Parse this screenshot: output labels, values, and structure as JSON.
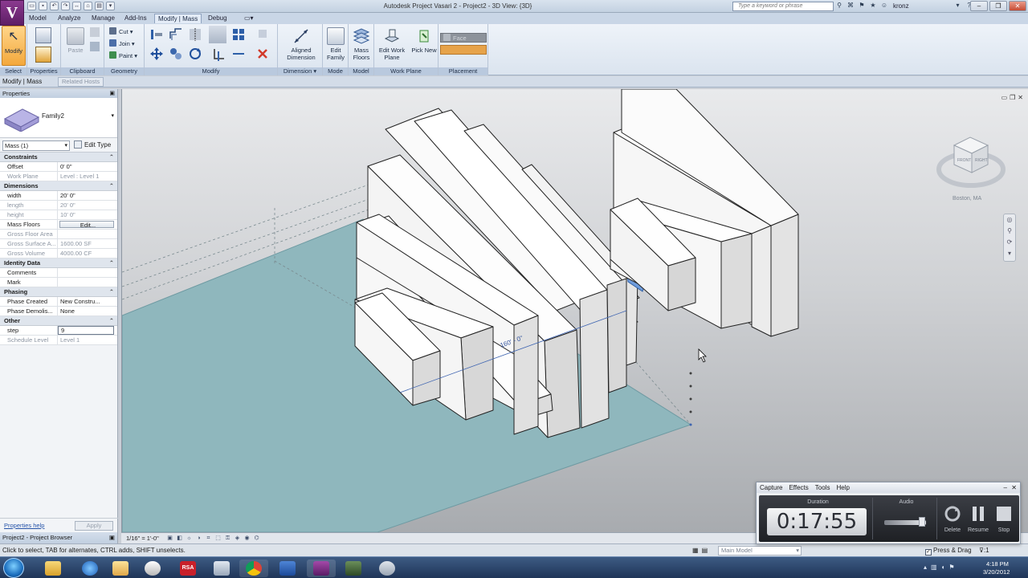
{
  "app": {
    "logo_letter": "V",
    "window_title": "Autodesk Project Vasari 2 - Project2 - 3D View: {3D}",
    "search_placeholder": "Type a keyword or phrase",
    "user_name": "kronz"
  },
  "ribbon_tabs": [
    "Model",
    "Analyze",
    "Manage",
    "Add-Ins",
    "Modify | Mass",
    "Debug"
  ],
  "active_tab": "Modify | Mass",
  "ribbon": {
    "modify_label": "Modify",
    "paste_label": "Paste",
    "cut_label": "Cut",
    "join_label": "Join",
    "paint_label": "Paint",
    "aligned_dimension_label": "Aligned Dimension",
    "edit_family_label": "Edit Family",
    "mass_floors_label": "Mass Floors",
    "edit_work_plane_label": "Edit Work Plane",
    "pick_new_label": "Pick New",
    "face_label": "Face",
    "groups": [
      "Select",
      "Properties",
      "Clipboard",
      "Geometry",
      "Modify",
      "Dimension",
      "Mode",
      "Model",
      "Work Plane",
      "Placement"
    ]
  },
  "options_bar": {
    "mode": "Modify | Mass",
    "related_hosts": "Related Hosts"
  },
  "properties": {
    "header": "Properties",
    "family_name": "Family2",
    "instance_filter": "Mass (1)",
    "edit_type": "Edit Type",
    "sections": [
      {
        "title": "Constraints",
        "rows": [
          {
            "name": "Offset",
            "value": "0' 0\"",
            "dim": false
          },
          {
            "name": "Work Plane",
            "value": "Level : Level 1",
            "dim": true
          }
        ]
      },
      {
        "title": "Dimensions",
        "rows": [
          {
            "name": "width",
            "value": "20' 0\"",
            "dim": false
          },
          {
            "name": "length",
            "value": "20' 0\"",
            "dim": true
          },
          {
            "name": "height",
            "value": "10' 0\"",
            "dim": true
          },
          {
            "name": "Mass Floors",
            "value": "Edit...",
            "dim": false,
            "button": true
          },
          {
            "name": "Gross Floor Area",
            "value": "",
            "dim": true
          },
          {
            "name": "Gross Surface A...",
            "value": "1600.00 SF",
            "dim": true
          },
          {
            "name": "Gross Volume",
            "value": "4000.00 CF",
            "dim": true
          }
        ]
      },
      {
        "title": "Identity Data",
        "rows": [
          {
            "name": "Comments",
            "value": "",
            "dim": false
          },
          {
            "name": "Mark",
            "value": "",
            "dim": false
          }
        ]
      },
      {
        "title": "Phasing",
        "rows": [
          {
            "name": "Phase Created",
            "value": "New Constru...",
            "dim": false
          },
          {
            "name": "Phase Demolis...",
            "value": "None",
            "dim": false
          }
        ]
      },
      {
        "title": "Other",
        "rows": [
          {
            "name": "step",
            "value": "9",
            "dim": false,
            "input": true
          },
          {
            "name": "Schedule Level",
            "value": "Level 1",
            "dim": true
          }
        ]
      }
    ],
    "help_link": "Properties help",
    "apply_button": "Apply"
  },
  "project_browser": "Project2 - Project Browser",
  "viewport": {
    "dimension_text": "160' - 0\"",
    "location": "Boston, MA",
    "viewcube_front": "FRONT",
    "viewcube_right": "RIGHT"
  },
  "view_bar": {
    "scale": "1/16\" = 1'-0\""
  },
  "status_bar": {
    "message": "Click to select, TAB for alternates, CTRL adds, SHIFT unselects.",
    "model": "Main Model",
    "press_drag": "Press & Drag",
    "filter_count": ":1"
  },
  "recorder": {
    "menu": [
      "Capture",
      "Effects",
      "Tools",
      "Help"
    ],
    "duration_label": "Duration",
    "duration_value": "0:17:55",
    "audio_label": "Audio",
    "audio_level": 0.9,
    "buttons": [
      "Delete",
      "Resume",
      "Stop"
    ]
  },
  "taskbar": {
    "time": "4:18 PM",
    "date": "3/20/2012",
    "apps": [
      "folder",
      "internet-explorer",
      "explorer",
      "app",
      "rsa",
      "files",
      "chrome",
      "word",
      "vasari",
      "app",
      "app"
    ],
    "rsa_label": "RSA"
  },
  "colors": {
    "ground": "#8fb7bd",
    "ribbon_label": "#b9c9de",
    "accent": "#2d6db8"
  }
}
